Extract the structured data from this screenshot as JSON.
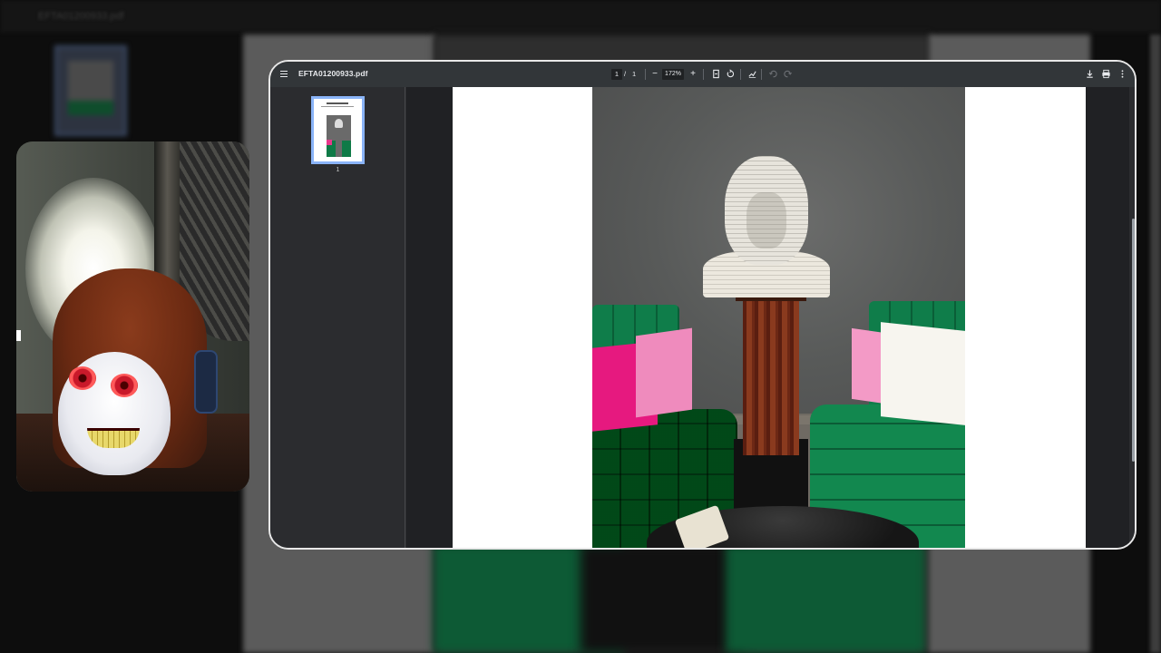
{
  "background": {
    "title": "EFTA01200933.pdf"
  },
  "viewer": {
    "filename": "EFTA01200933.pdf",
    "current_page": "1",
    "page_separator": "/",
    "total_pages": "1",
    "zoom": "172%",
    "zoom_out_glyph": "−",
    "zoom_in_glyph": "+",
    "sidebar": {
      "thumbnails": [
        {
          "label": "1",
          "selected": true
        }
      ]
    },
    "icons": {
      "menu": "hamburger-menu-icon",
      "fit_page": "fit-page-icon",
      "rotate": "rotate-icon",
      "annotate": "annotate-icon",
      "undo": "undo-icon",
      "redo": "redo-icon",
      "download": "download-icon",
      "print": "print-icon",
      "more": "more-vert-icon"
    },
    "colors": {
      "toolbar": "#323639",
      "content_bg": "#202124",
      "thumbnail_selected": "#8ab4f8"
    }
  }
}
